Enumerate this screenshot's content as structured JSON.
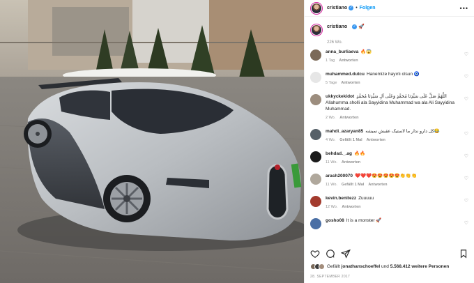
{
  "header": {
    "username": "cristiano",
    "dot": "•",
    "follow_label": "Folgen",
    "more_icon": "more-horizontal-icon"
  },
  "caption": {
    "username": "cristiano",
    "emoji": "🚀",
    "time": "226 Wo."
  },
  "comments": [
    {
      "user": "anna_burliaeva",
      "text": "🔥😱",
      "time": "1 Tag",
      "likes": "",
      "reply": "Antworten",
      "avatar_color": "#7b6a58"
    },
    {
      "user": "muhammed.dutcu",
      "text": "Hanemize hayırlı olsun 🧿",
      "time": "5 Tage",
      "likes": "",
      "reply": "Antworten",
      "avatar_color": "#e6e6e6"
    },
    {
      "user": "ukkyckekidot",
      "text": "اللَّهُمَّ صَلِّ عَلَى سَيِّدِنَا مُحَمَّدٍ وَعَلَى آلِ سَيِّدِنَا مُحَمَّدٍ Allahumma sholli ala Sayyidina Muhammad wa ala Ali Sayyidina Muhammad.",
      "time": "2 Wo.",
      "likes": "",
      "reply": "Antworten",
      "avatar_color": "#9c8d7e"
    },
    {
      "user": "mahdi_azaryan85",
      "text": "کل دارو ندار ما لاستیک عقبش نمیشه😂",
      "time": "4 Wo.",
      "likes": "Gefällt 1 Mal",
      "reply": "Antworten",
      "avatar_color": "#566068"
    },
    {
      "user": "behdad._.ag",
      "text": "🔥🔥",
      "time": "11 Wo.",
      "likes": "",
      "reply": "Antworten",
      "avatar_color": "#1a1a1a"
    },
    {
      "user": "arash200070",
      "text": "❤️❤️❤️😍😍😍😍😍👏👏👏",
      "time": "11 Wo.",
      "likes": "Gefällt 1 Mal",
      "reply": "Antworten",
      "avatar_color": "#b0a89c"
    },
    {
      "user": "kevin.benitezz",
      "text": "Zuuuuu",
      "time": "12 Wo.",
      "likes": "",
      "reply": "Antworten",
      "avatar_color": "#a33b2e"
    },
    {
      "user": "gosho08",
      "text": "It is a monster 🚀",
      "time": "",
      "likes": "",
      "reply": "",
      "avatar_color": "#4a6fa5"
    }
  ],
  "likes": {
    "prefix": "Gefällt ",
    "user": "jonathanschoeffel",
    "middle": " und ",
    "count": "5.568.412 weitere Personen"
  },
  "date": "28. SEPTEMBER 2017",
  "icons": [
    "heart-icon",
    "comment-icon",
    "share-icon",
    "bookmark-icon"
  ],
  "colors": {
    "accent": "#0095f6",
    "verified": "#3897f0",
    "muted": "#8e8e8e"
  }
}
